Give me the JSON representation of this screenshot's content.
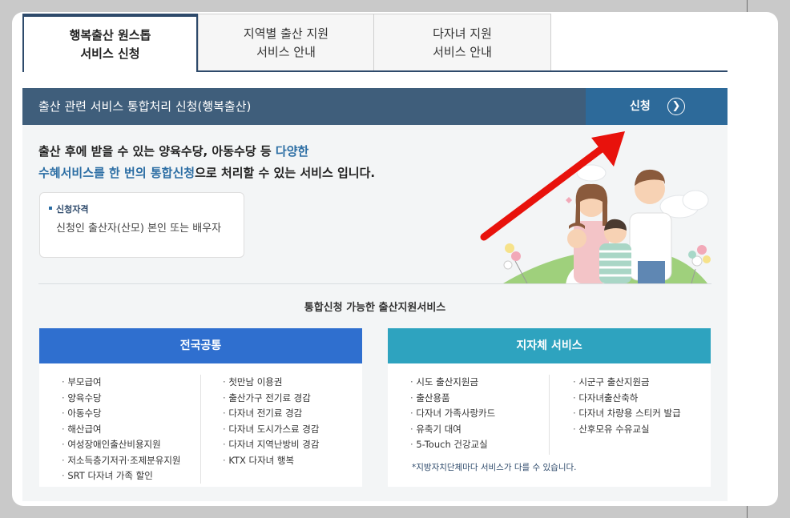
{
  "tabs": [
    {
      "line1": "행복출산 원스톱",
      "line2": "서비스 신청",
      "active": true
    },
    {
      "line1": "지역별 출산 지원",
      "line2": "서비스 안내",
      "active": false
    },
    {
      "line1": "다자녀 지원",
      "line2": "서비스 안내",
      "active": false
    }
  ],
  "banner": {
    "title": "출산 관련 서비스 통합처리 신청(행복출산)",
    "apply_label": "신청",
    "apply_icon": "chevron-right-circle-icon"
  },
  "intro": {
    "part1": "출산 후에 받을 수 있는 양육수당, 아동수당 등 ",
    "part2": "다양한",
    "part3": "수혜서비스를 한 번의 통합신청",
    "part4": "으로 처리할 수 있는 서비스 입니다."
  },
  "qualification": {
    "title": "신청자격",
    "text": "신청인 출산자(산모) 본인 또는 배우자"
  },
  "services_title": "통합신청 가능한 출산지원서비스",
  "national": {
    "title": "전국공통",
    "color": "#2f6fcf",
    "left": [
      "부모급여",
      "양육수당",
      "아동수당",
      "해산급여",
      "여성장애인출산비용지원",
      "저소득층기저귀·조제분유지원",
      "SRT 다자녀 가족 할인"
    ],
    "right": [
      "첫만남 이용권",
      "출산가구 전기료 경감",
      "다자녀 전기료 경감",
      "다자녀 도시가스료 경감",
      "다자녀 지역난방비 경감",
      "KTX 다자녀 행복"
    ]
  },
  "local": {
    "title": "지자체 서비스",
    "color": "#2ea3bf",
    "left": [
      "시도 출산지원금",
      "출산용품",
      "다자녀 가족사랑카드",
      "유축기 대여",
      "5-Touch 건강교실"
    ],
    "right": [
      "시군구 출산지원금",
      "다자녀출산축하",
      "다자녀 차량용 스티커 발급",
      "산후모유 수유교실"
    ],
    "note": "*지방자치단체마다 서비스가 다를 수 있습니다."
  }
}
